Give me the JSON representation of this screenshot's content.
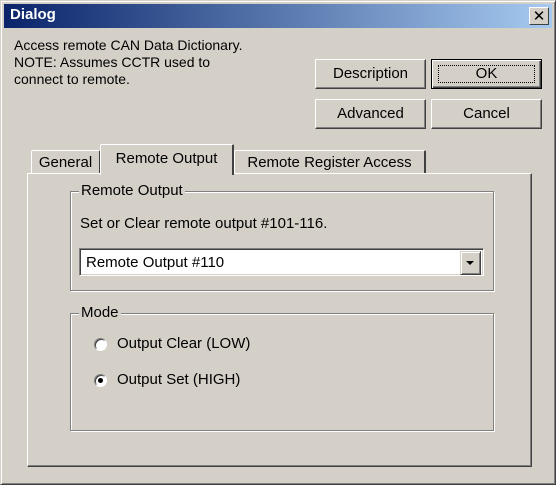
{
  "window": {
    "title": "Dialog",
    "close_glyph": "✕"
  },
  "description": {
    "line1": "Access remote CAN Data Dictionary.",
    "line2": "NOTE:  Assumes CCTR used to",
    "line3": "connect to remote."
  },
  "buttons": {
    "description": "Description",
    "ok": "OK",
    "advanced": "Advanced",
    "cancel": "Cancel"
  },
  "tabs": [
    {
      "label": "General",
      "active": false
    },
    {
      "label": "Remote Output",
      "active": true
    },
    {
      "label": "Remote Register Access",
      "active": false
    }
  ],
  "remote_output_group": {
    "legend": "Remote Output",
    "instruction": "Set or Clear remote output #101-116.",
    "selected_output": "Remote Output #110",
    "dropdown_icon": "chevron-down-icon"
  },
  "mode_group": {
    "legend": "Mode",
    "options": [
      {
        "label": "Output Clear (LOW)",
        "selected": false
      },
      {
        "label": "Output Set (HIGH)",
        "selected": true
      }
    ]
  },
  "colors": {
    "face": "#d4d0c8",
    "title_start": "#0a246a",
    "title_end": "#a6caf0"
  }
}
